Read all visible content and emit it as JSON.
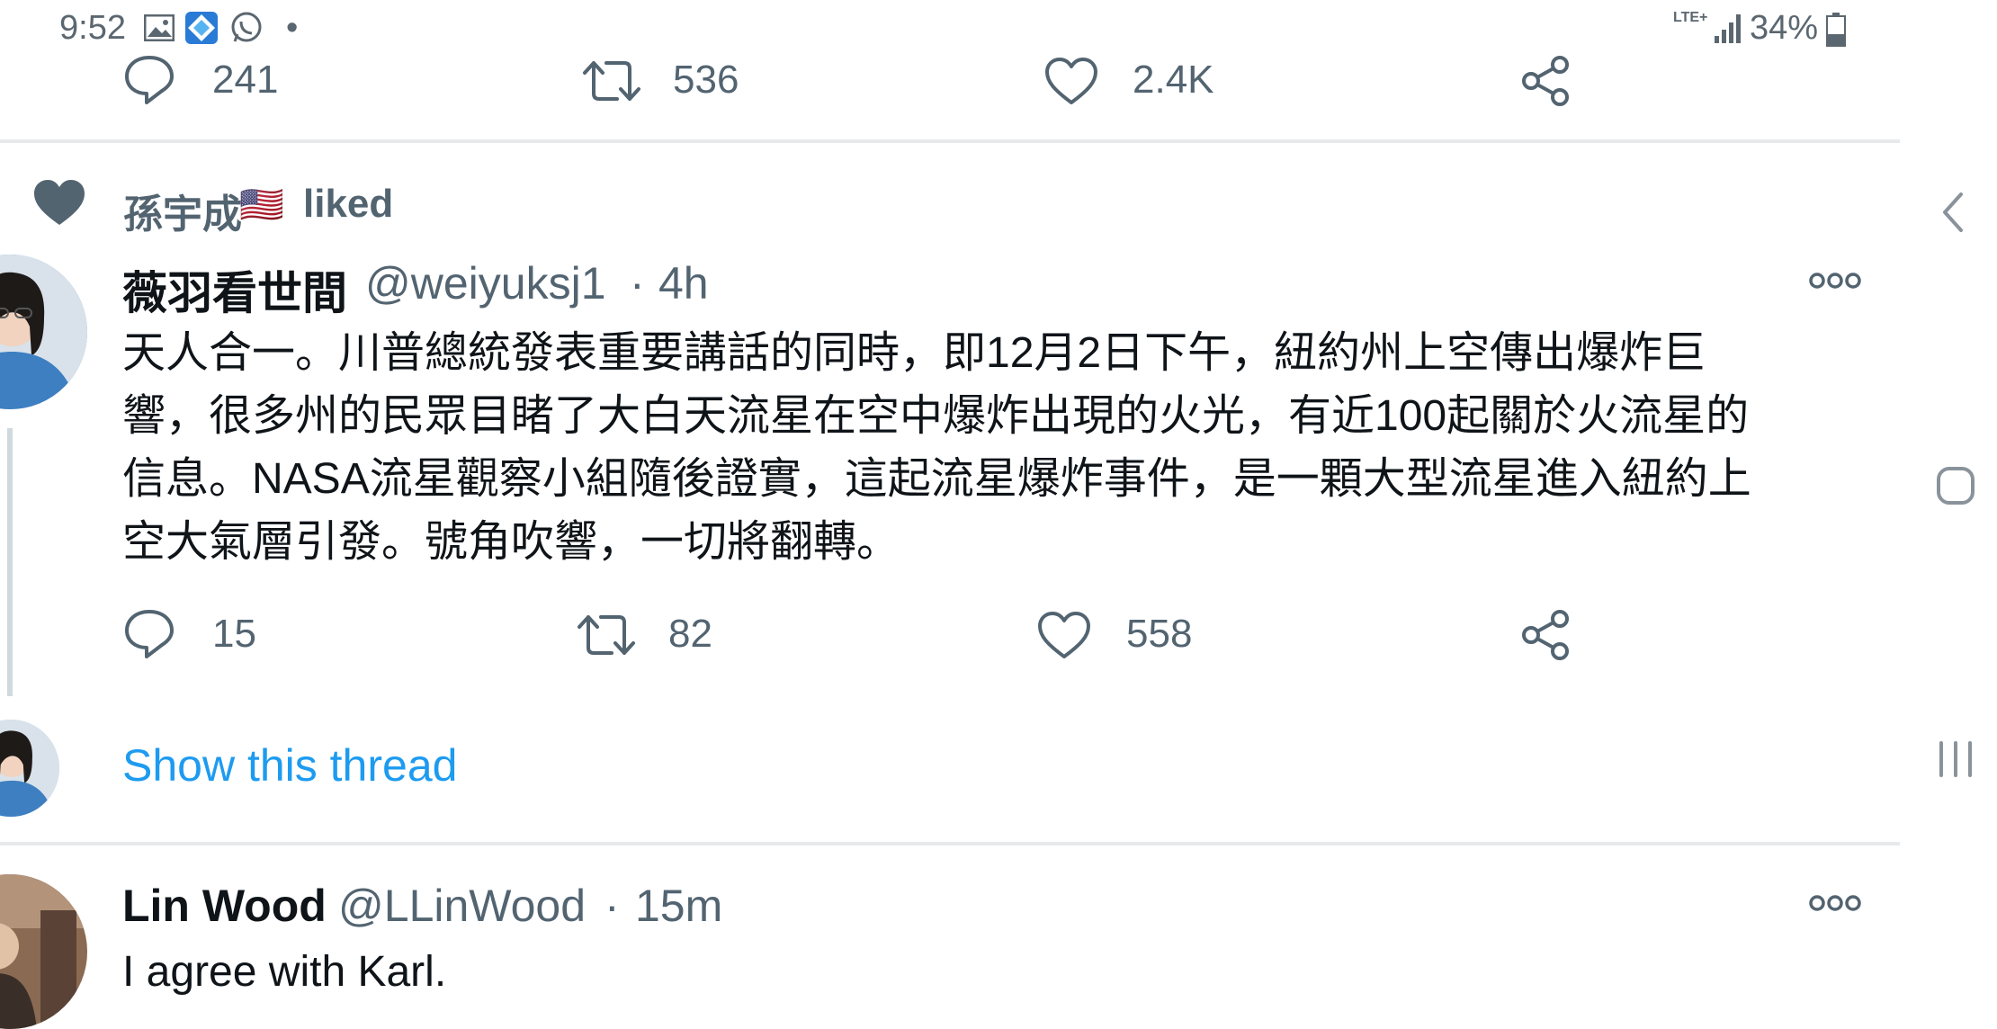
{
  "status_bar": {
    "time": "9:52",
    "dot": "•",
    "network": "LTE+",
    "battery": "34%"
  },
  "top_actions": {
    "reply_count": "241",
    "retweet_count": "536",
    "like_count": "2.4K"
  },
  "liked_banner": {
    "user": "孫宇成",
    "flag": "🇺🇸",
    "action": "liked"
  },
  "tweet1": {
    "display_name": "薇羽看世間",
    "handle": "@weiyuksj1",
    "separator": "·",
    "time": "4h",
    "lines": [
      "天人合一。川普總統發表重要講話的同時，即12月2日下午，紐約州上空傳出爆炸巨",
      "響，很多州的民眾目睹了大白天流星在空中爆炸出現的火光，有近100起關於火流星的",
      "信息。NASA流星觀察小組隨後證實，這起流星爆炸事件，是一顆大型流星進入紐約上",
      "空大氣層引發。號角吹響，一切將翻轉。"
    ],
    "reply_count": "15",
    "retweet_count": "82",
    "like_count": "558"
  },
  "show_thread": {
    "label": "Show this thread"
  },
  "tweet2": {
    "display_name": "Lin Wood",
    "handle": "@LLinWood",
    "separator": "·",
    "time": "15m",
    "text": "I agree with Karl."
  },
  "colors": {
    "link_blue": "#1d9bf0",
    "muted_gray": "#536471",
    "divider": "#e7e9eb"
  },
  "icons": {
    "status": [
      "gallery-icon",
      "app-icon",
      "whatsapp-icon",
      "signal-icon",
      "battery-icon"
    ],
    "actions": [
      "reply-icon",
      "retweet-icon",
      "like-icon",
      "share-icon",
      "more-icon"
    ],
    "nav": [
      "back-icon",
      "home-icon",
      "recents-icon"
    ]
  }
}
